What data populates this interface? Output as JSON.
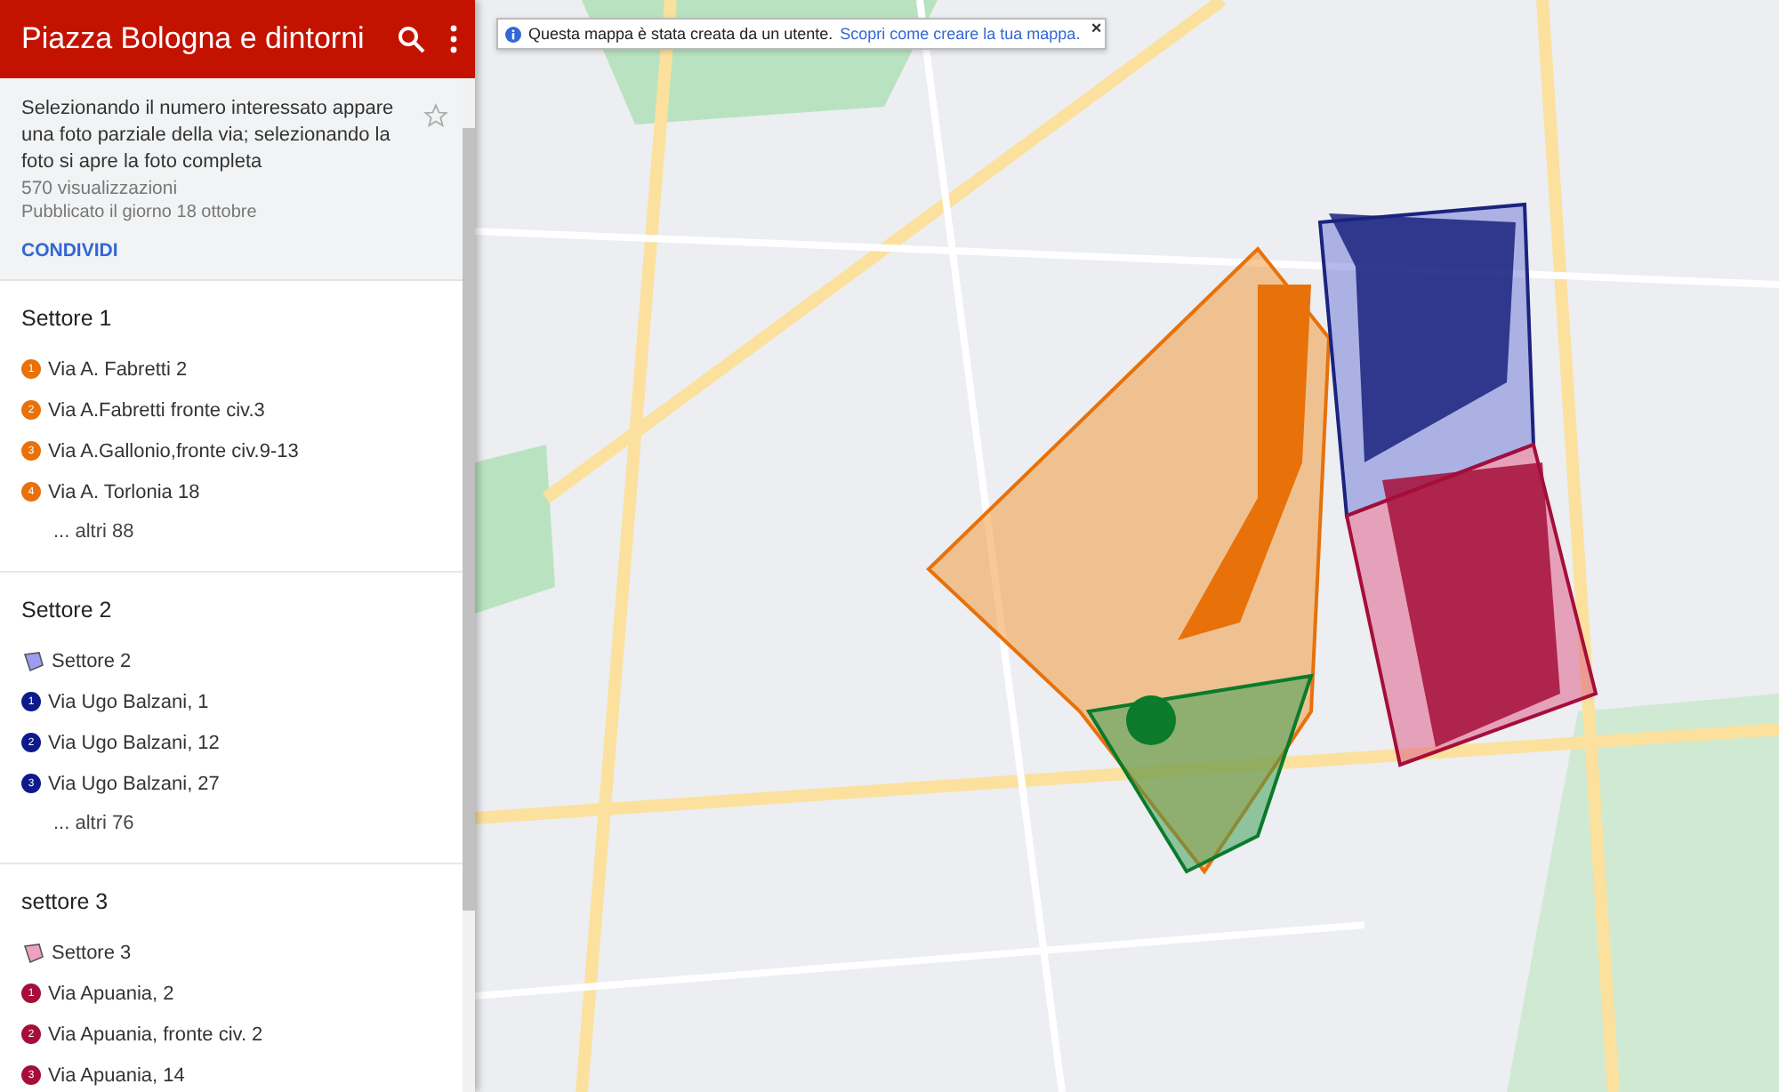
{
  "header": {
    "title": "Piazza Bologna e dintorni"
  },
  "info": {
    "description": "Selezionando il numero interessato appare una foto parziale della via; selezionando la foto si apre la foto completa",
    "views": "570 visualizzazioni",
    "published": "Pubblicato il giorno 18 ottobre",
    "share": "CONDIVIDI",
    "starred": false
  },
  "layers": [
    {
      "title": "Settore 1",
      "items": [
        {
          "kind": "marker",
          "number": "1",
          "label": "Via A. Fabretti 2",
          "color": "#e8710a"
        },
        {
          "kind": "marker",
          "number": "2",
          "label": "Via A.Fabretti fronte civ.3",
          "color": "#e8710a"
        },
        {
          "kind": "marker",
          "number": "3",
          "label": "Via A.Gallonio,fronte civ.9-13",
          "color": "#e8710a"
        },
        {
          "kind": "marker",
          "number": "4",
          "label": "Via A. Torlonia 18",
          "color": "#e8710a"
        }
      ],
      "more": "... altri 88"
    },
    {
      "title": "Settore 2",
      "items": [
        {
          "kind": "polygon",
          "label": "Settore 2",
          "color": "#9c9cf0"
        },
        {
          "kind": "marker",
          "number": "1",
          "label": "Via Ugo Balzani, 1",
          "color": "#0d1a8a"
        },
        {
          "kind": "marker",
          "number": "2",
          "label": "Via Ugo Balzani, 12",
          "color": "#0d1a8a"
        },
        {
          "kind": "marker",
          "number": "3",
          "label": "Via Ugo Balzani, 27",
          "color": "#0d1a8a"
        }
      ],
      "more": "... altri 76"
    },
    {
      "title": "settore 3",
      "items": [
        {
          "kind": "polygon",
          "label": "Settore 3",
          "color": "#f0a0c0"
        },
        {
          "kind": "marker",
          "number": "1",
          "label": "Via Apuania, 2",
          "color": "#a50e3a"
        },
        {
          "kind": "marker",
          "number": "2",
          "label": "Via Apuania, fronte civ. 2",
          "color": "#a50e3a"
        },
        {
          "kind": "marker",
          "number": "3",
          "label": "Via Apuania, 14",
          "color": "#a50e3a"
        }
      ]
    }
  ],
  "banner": {
    "text": "Questa mappa è stata creata da un utente.",
    "link": "Scopri come creare la tua mappa.",
    "close": "×"
  }
}
